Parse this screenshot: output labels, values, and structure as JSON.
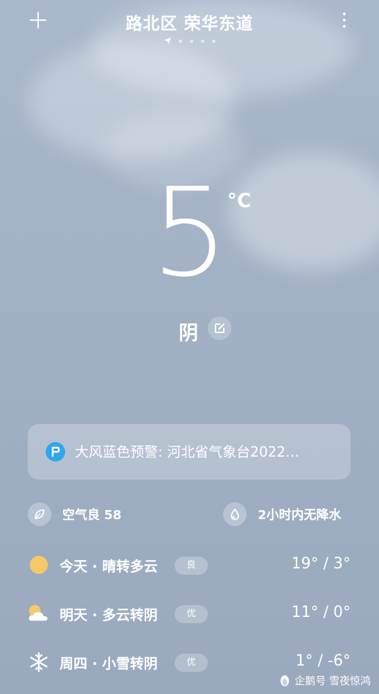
{
  "header": {
    "title": "路北区 荣华东道",
    "page_count": 5,
    "active_page": 0
  },
  "weather": {
    "temperature": "5",
    "unit": "°C",
    "condition": "阴"
  },
  "alert": {
    "text": "大风蓝色预警: 河北省气象台2022…"
  },
  "info": {
    "air_quality": "空气良 58",
    "precip": "2小时内无降水"
  },
  "forecast": [
    {
      "icon": "sun-icon",
      "label": "今天 · 晴转多云",
      "badge": "良",
      "temp": "19° / 3°"
    },
    {
      "icon": "partly-cloudy-icon",
      "label": "明天 · 多云转阴",
      "badge": "优",
      "temp": "11° / 0°"
    },
    {
      "icon": "snowflake-icon",
      "label": "周四 · 小雪转阴",
      "badge": "优",
      "temp": "1° / -6°"
    }
  ],
  "watermark": {
    "text": "企鹅号 雪夜惊鸿"
  },
  "colors": {
    "background": "#a4b3c6",
    "alert_icon": "#2ea7ee",
    "sun": "#f5c96a"
  }
}
